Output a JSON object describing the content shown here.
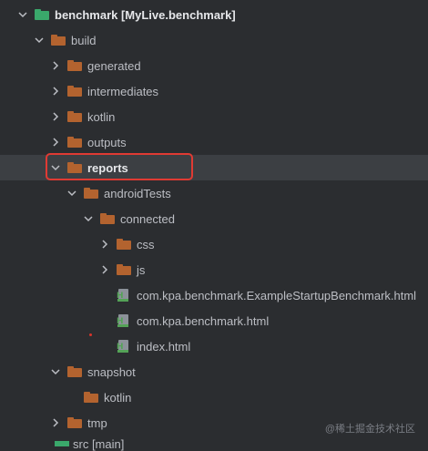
{
  "tree": [
    {
      "label": "benchmark [MyLive.benchmark]",
      "kind": "module",
      "expanded": true,
      "depth": 0
    },
    {
      "label": "build",
      "kind": "folder",
      "expanded": true,
      "depth": 1
    },
    {
      "label": "generated",
      "kind": "folder",
      "expanded": false,
      "depth": 2
    },
    {
      "label": "intermediates",
      "kind": "folder",
      "expanded": false,
      "depth": 2
    },
    {
      "label": "kotlin",
      "kind": "folder",
      "expanded": false,
      "depth": 2
    },
    {
      "label": "outputs",
      "kind": "folder",
      "expanded": false,
      "depth": 2
    },
    {
      "label": "reports",
      "kind": "folder",
      "expanded": true,
      "depth": 2,
      "selected": true
    },
    {
      "label": "androidTests",
      "kind": "folder",
      "expanded": true,
      "depth": 3
    },
    {
      "label": "connected",
      "kind": "folder",
      "expanded": true,
      "depth": 4
    },
    {
      "label": "css",
      "kind": "folder",
      "expanded": false,
      "depth": 5
    },
    {
      "label": "js",
      "kind": "folder",
      "expanded": false,
      "depth": 5
    },
    {
      "label": "com.kpa.benchmark.ExampleStartupBenchmark.html",
      "kind": "html",
      "depth": 5
    },
    {
      "label": "com.kpa.benchmark.html",
      "kind": "html",
      "depth": 5
    },
    {
      "label": "index.html",
      "kind": "html",
      "depth": 5
    },
    {
      "label": "snapshot",
      "kind": "folder",
      "expanded": true,
      "depth": 2
    },
    {
      "label": "kotlin",
      "kind": "folder",
      "depth": 3
    },
    {
      "label": "tmp",
      "kind": "folder",
      "expanded": false,
      "depth": 2
    }
  ],
  "partial_bottom_label": "src [main]",
  "watermark": "@稀土掘金技术社区",
  "colors": {
    "background": "#2b2d30",
    "selected_row": "#3c3f43",
    "folder": "#b3632f",
    "module": "#3aa86b",
    "highlight_border": "#e03a33"
  }
}
